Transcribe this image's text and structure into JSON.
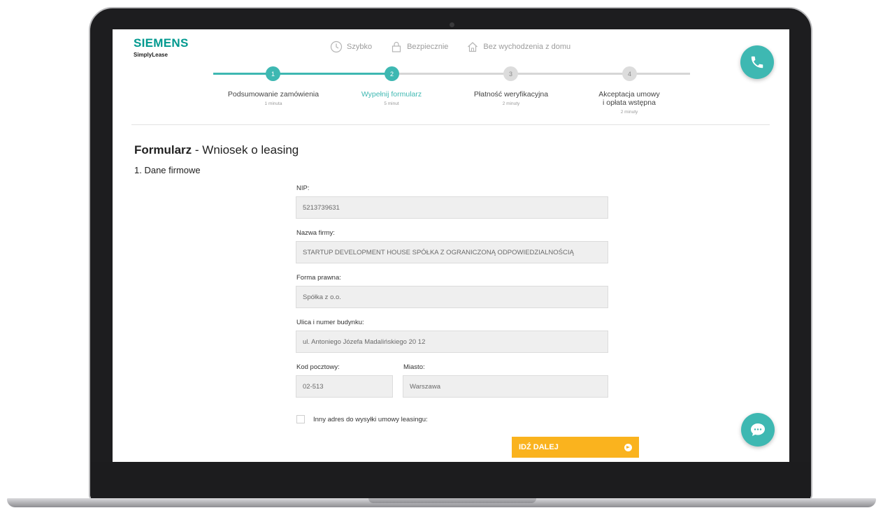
{
  "brand": {
    "name": "SIEMENS",
    "product": "SimplyLease"
  },
  "features": [
    {
      "icon": "clock-icon",
      "label": "Szybko"
    },
    {
      "icon": "lock-icon",
      "label": "Bezpiecznie"
    },
    {
      "icon": "home-icon",
      "label": "Bez wychodzenia z domu"
    }
  ],
  "steps": [
    {
      "number": "1",
      "label": "Podsumowanie zamówienia",
      "time": "1 minuta",
      "status": "done"
    },
    {
      "number": "2",
      "label": "Wypełnij formularz",
      "time": "5 minut",
      "status": "active"
    },
    {
      "number": "3",
      "label": "Płatność weryfikacyjna",
      "time": "2 minuty",
      "status": "todo"
    },
    {
      "number": "4",
      "label_line1": "Akceptacja umowy",
      "label_line2": "i opłata wstępna",
      "time": "2 minuty",
      "status": "todo"
    }
  ],
  "form": {
    "title_bold": "Formularz",
    "title_rest": " - Wniosek o leasing",
    "section": "1. Dane firmowe",
    "fields": {
      "nip": {
        "label": "NIP:",
        "value": "5213739631"
      },
      "company": {
        "label": "Nazwa firmy:",
        "value": "STARTUP DEVELOPMENT HOUSE SPÓŁKA Z OGRANICZONĄ ODPOWIEDZIALNOŚCIĄ"
      },
      "legal_form": {
        "label": "Forma prawna:",
        "value": "Spółka z o.o."
      },
      "street": {
        "label": "Ulica i numer budynku:",
        "value": "ul. Antoniego Józefa Madalińskiego 20 12"
      },
      "postal": {
        "label": "Kod pocztowy:",
        "value": "02-513"
      },
      "city": {
        "label": "Miasto:",
        "value": "Warszawa"
      }
    },
    "other_address_label": "Inny adres do wysyłki umowy leasingu:",
    "next_button": "IDŹ DALEJ"
  },
  "colors": {
    "accent": "#3eb8b2",
    "brand": "#00998f",
    "button": "#fab31e"
  }
}
